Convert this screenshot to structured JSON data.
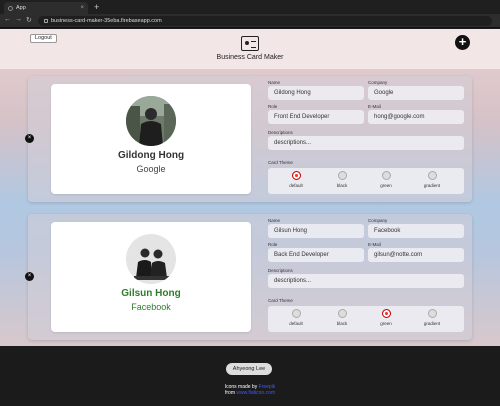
{
  "browser": {
    "tab_title": "App",
    "new_tab": "+",
    "url": "business-card-maker-35eba.firebaseapp.com"
  },
  "header": {
    "logout_label": "Logout",
    "title": "Business Card Maker",
    "add_label": "+"
  },
  "cards": [
    {
      "name": "Gildong Hong",
      "company": "Google",
      "role": "Front End Developer",
      "email": "hong@google.com",
      "descriptions": "descriptions...",
      "theme": "default"
    },
    {
      "name": "Gilsun Hong",
      "company": "Facebook",
      "role": "Back End Developer",
      "email": "gilsun@notte.com",
      "descriptions": "descriptions...",
      "theme": "green"
    }
  ],
  "form_labels": {
    "name": "Name",
    "company": "Company",
    "role": "Role",
    "email": "E-Mail",
    "descriptions": "Descriptions",
    "card_theme": "Card Theme"
  },
  "themes": [
    "default",
    "black",
    "green",
    "gradient"
  ],
  "delete_icon": "×",
  "footer": {
    "author": "Ahyeong Lee",
    "credit_prefix": "Icons made by",
    "credit_author": "Freepik",
    "credit_from": "from",
    "credit_site": "www.flaticon.com"
  },
  "colors": {
    "selected_radio": "#ee3333",
    "green_theme_text": "#2f7d2a"
  }
}
